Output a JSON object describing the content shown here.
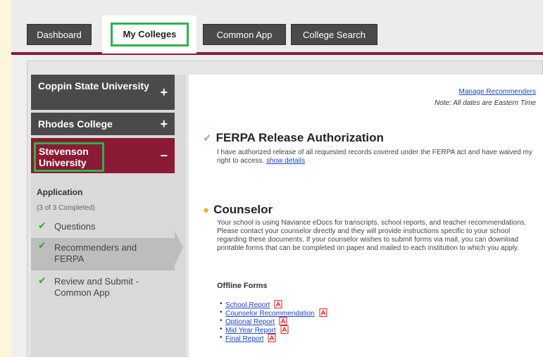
{
  "tabs": [
    {
      "label": "Dashboard"
    },
    {
      "label": "My Colleges"
    },
    {
      "label": "Common App"
    },
    {
      "label": "College Search"
    }
  ],
  "colleges": [
    {
      "name": "Coppin State University",
      "sign": "+"
    },
    {
      "name": "Rhodes College",
      "sign": "+"
    },
    {
      "name": "Stevenson University",
      "sign": "−"
    }
  ],
  "application": {
    "title": "Application",
    "count": "(3 of 3 Completed)",
    "steps": [
      {
        "label": "Questions"
      },
      {
        "label": "Recommenders and FERPA"
      },
      {
        "label": "Review and Submit - Common App"
      }
    ]
  },
  "content": {
    "manage_link": "Manage Recommenders",
    "note": "Note: All dates are Eastern Time",
    "ferpa": {
      "title": "FERPA Release Authorization",
      "text": "I have authorized release of all requested records covered under the FERPA act and have waived my right to access.",
      "link": "show details"
    },
    "counselor": {
      "title": "Counselor",
      "text": "Your school is using Naviance eDocs for transcripts, school reports, and teacher recommendations. Please contact your counselor directly and they will provide instructions specific to your school regarding these documents. If your counselor wishes to submit forms via mail, you can download printable forms that can be completed on paper and mailed to each institution to which you apply."
    },
    "offline_title": "Offline Forms",
    "forms": [
      {
        "label": "School Report"
      },
      {
        "label": "Counselor Recommendation"
      },
      {
        "label": "Optional Report"
      },
      {
        "label": "Mid Year Report"
      },
      {
        "label": "Final Report"
      }
    ]
  },
  "colors": {
    "accent": "#8b1a35",
    "highlight": "#2db34a",
    "link": "#1a44cc"
  }
}
